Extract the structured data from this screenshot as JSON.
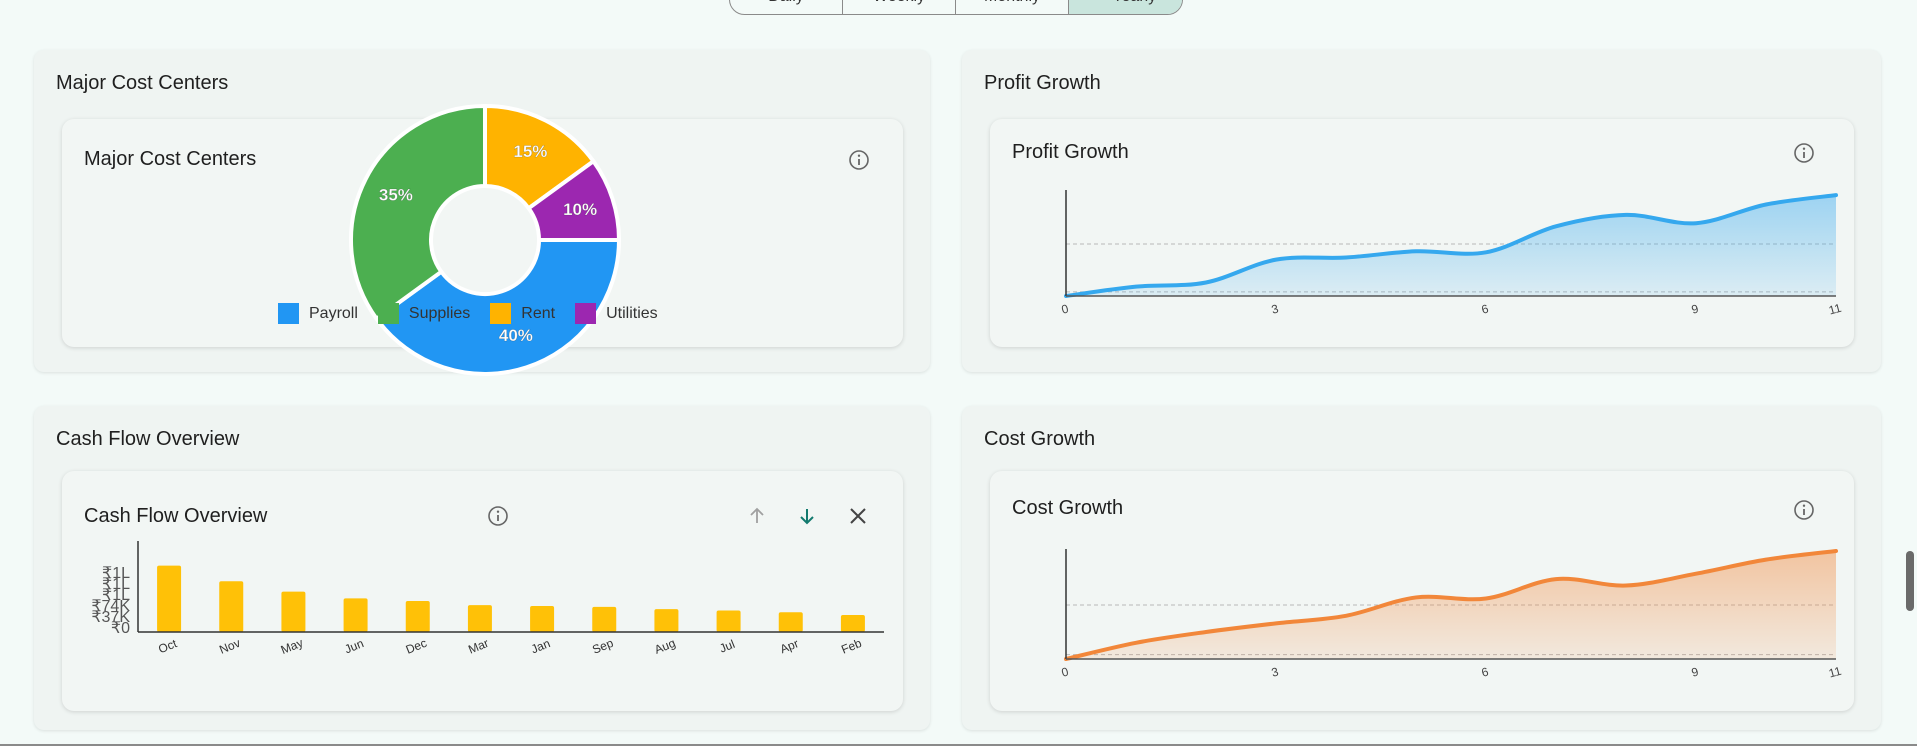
{
  "period_selector": {
    "options": [
      "Daily",
      "Weekly",
      "Monthly",
      "✓ Yearly"
    ],
    "selected": "Yearly"
  },
  "cards": {
    "cost_centers": {
      "title": "Major Cost Centers",
      "inner_title": "Major Cost Centers"
    },
    "profit_growth": {
      "title": "Profit Growth",
      "inner_title": "Profit Growth"
    },
    "cash_flow": {
      "title": "Cash Flow Overview",
      "inner_title": "Cash Flow Overview"
    },
    "cost_growth": {
      "title": "Cost Growth",
      "inner_title": "Cost Growth"
    }
  },
  "icons": {
    "info": "info-icon",
    "sort_up": "arrow-up-icon",
    "sort_down": "arrow-down-icon",
    "close": "close-icon"
  },
  "colors": {
    "payroll": "#2196f3",
    "supplies": "#4caf50",
    "rent": "#ffb300",
    "utilities": "#9c27b0",
    "profit": "#35a8ee",
    "cost": "#f2873a",
    "bar": "#ffc107"
  },
  "chart_data": [
    {
      "type": "pie",
      "title": "Major Cost Centers",
      "categories": [
        "Payroll",
        "Supplies",
        "Rent",
        "Utilities"
      ],
      "values": [
        40,
        35,
        15,
        10
      ],
      "labels": [
        "40%",
        "35%",
        "15%",
        "10%"
      ],
      "legend": "bottom"
    },
    {
      "type": "area",
      "title": "Profit Growth",
      "x": [
        0,
        1,
        2,
        3,
        4,
        5,
        6,
        7,
        8,
        9,
        10,
        11
      ],
      "y": [
        0,
        0.09,
        0.13,
        0.35,
        0.37,
        0.43,
        0.42,
        0.67,
        0.78,
        0.7,
        0.88,
        0.97
      ],
      "x_ticks": [
        "0",
        "3",
        "6",
        "9",
        "11"
      ],
      "xlim": [
        0,
        11
      ],
      "ylim": [
        0,
        1
      ],
      "grid": true
    },
    {
      "type": "bar",
      "title": "Cash Flow Overview",
      "categories": [
        "Oct",
        "Nov",
        "May",
        "Jun",
        "Dec",
        "Mar",
        "Jan",
        "Sep",
        "Aug",
        "Jul",
        "Apr",
        "Feb"
      ],
      "values": [
        148000,
        113000,
        90000,
        75000,
        69000,
        60000,
        58000,
        56000,
        51000,
        48000,
        44000,
        38000
      ],
      "y_ticks": [
        "₹0",
        "₹37K",
        "₹74K",
        "₹1L",
        "₹1L",
        "₹1L"
      ],
      "ylim": [
        0,
        185000
      ]
    },
    {
      "type": "area",
      "title": "Cost Growth",
      "x": [
        0,
        1,
        2,
        3,
        4,
        5,
        6,
        7,
        8,
        9,
        10,
        11
      ],
      "y": [
        0,
        0.15,
        0.25,
        0.33,
        0.4,
        0.57,
        0.56,
        0.74,
        0.68,
        0.79,
        0.92,
        1.0
      ],
      "x_ticks": [
        "0",
        "3",
        "6",
        "9",
        "11"
      ],
      "xlim": [
        0,
        11
      ],
      "ylim": [
        0,
        1
      ],
      "grid": true
    }
  ]
}
